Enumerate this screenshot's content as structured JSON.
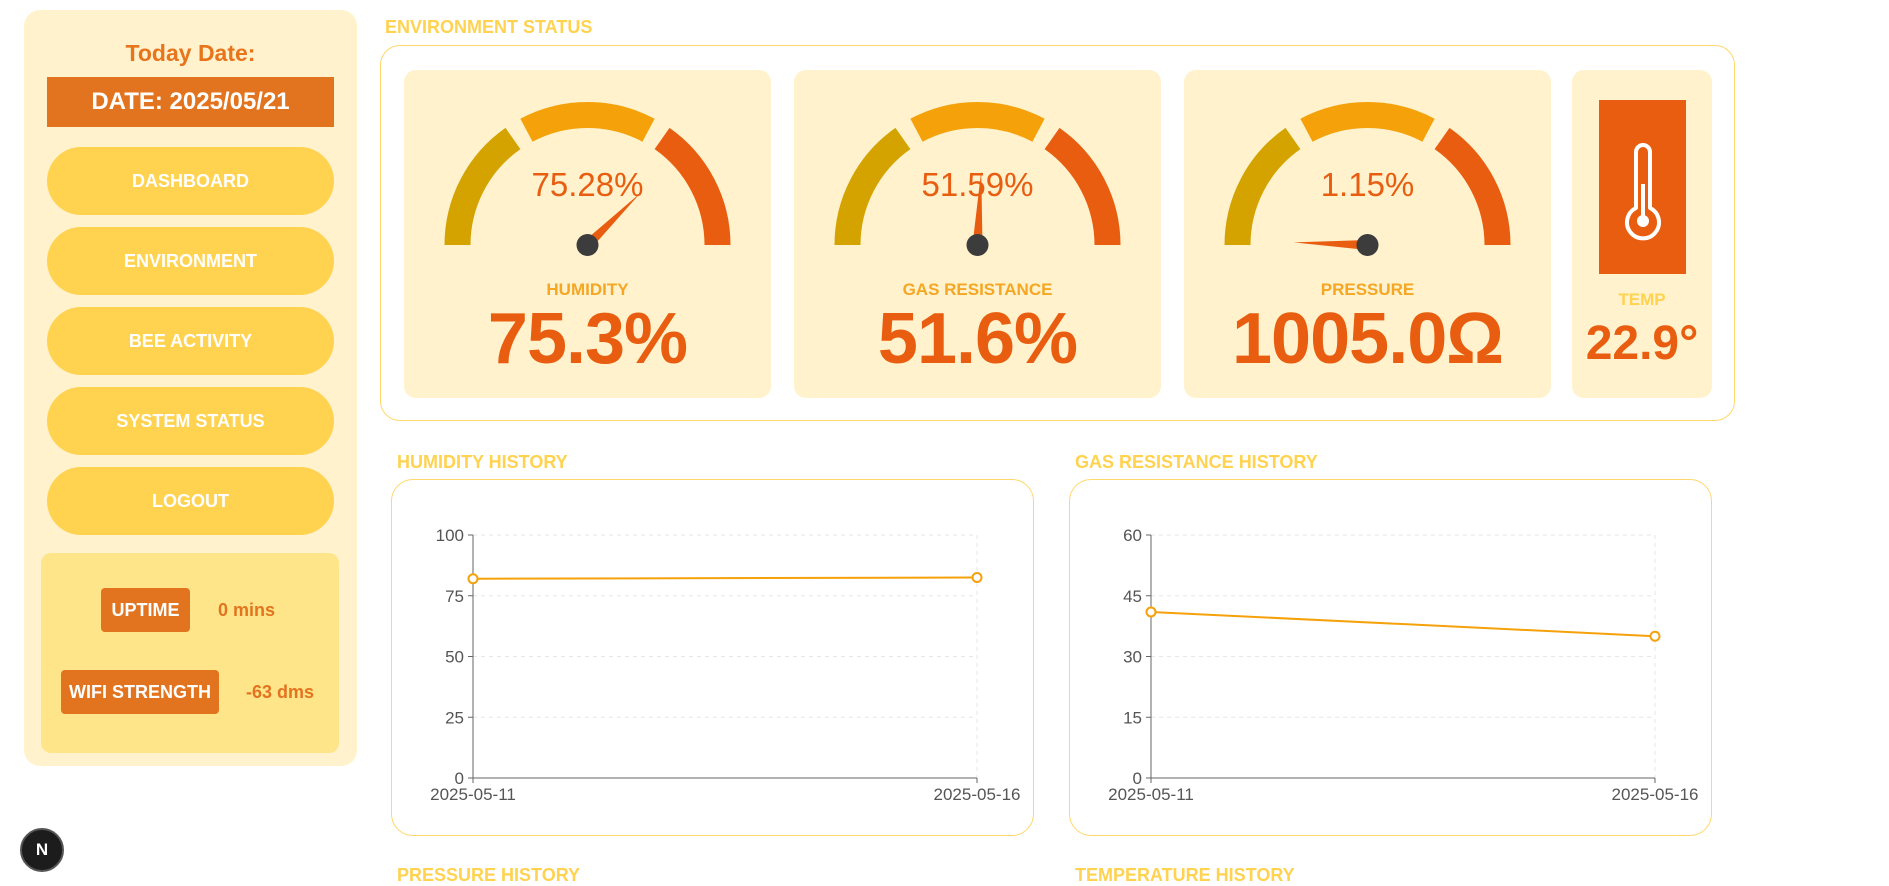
{
  "sidebar": {
    "today_label": "Today Date:",
    "date": "DATE: 2025/05/21",
    "nav": [
      {
        "label": "DASHBOARD"
      },
      {
        "label": "ENVIRONMENT"
      },
      {
        "label": "BEE ACTIVITY"
      },
      {
        "label": "SYSTEM STATUS"
      },
      {
        "label": "LOGOUT"
      }
    ],
    "uptime_label": "UPTIME",
    "uptime_value": "0 mins",
    "wifi_label": "WIFI STRENGTH",
    "wifi_value": "-63 dms"
  },
  "environment": {
    "title": "ENVIRONMENT STATUS",
    "gauges": [
      {
        "label": "HUMIDITY",
        "percent_text": "75.28%",
        "value_text": "75.3%",
        "percent": 75.28
      },
      {
        "label": "GAS RESISTANCE",
        "percent_text": "51.59%",
        "value_text": "51.6%",
        "percent": 51.59
      },
      {
        "label": "PRESSURE",
        "percent_text": "1.15%",
        "value_text": "1005.0Ω",
        "percent": 1.15
      }
    ],
    "temp": {
      "label": "TEMP",
      "value_text": "22.9°",
      "icon": "thermometer-icon"
    }
  },
  "colors": {
    "gauge_low": "#d4a300",
    "gauge_mid": "#f5a10a",
    "gauge_high": "#e85d10",
    "needle": "#e85d10",
    "pivot": "#3c3c3c",
    "line": "#f5a10a"
  },
  "history": {
    "humidity_title": "HUMIDITY HISTORY",
    "gas_title": "GAS RESISTANCE HISTORY",
    "pressure_title": "PRESSURE HISTORY",
    "temperature_title": "TEMPERATURE HISTORY"
  },
  "chart_data": [
    {
      "type": "line",
      "title": "HUMIDITY HISTORY",
      "x": [
        "2025-05-11",
        "2025-05-16"
      ],
      "y_ticks": [
        0,
        25,
        50,
        75,
        100
      ],
      "ylim": [
        0,
        100
      ],
      "series": [
        {
          "values": [
            82,
            82.5
          ]
        }
      ],
      "grid": true
    },
    {
      "type": "line",
      "title": "GAS RESISTANCE HISTORY",
      "x": [
        "2025-05-11",
        "2025-05-16"
      ],
      "y_ticks": [
        0,
        15,
        30,
        45,
        60
      ],
      "ylim": [
        0,
        60
      ],
      "series": [
        {
          "values": [
            41,
            35
          ]
        }
      ],
      "grid": true
    }
  ],
  "floating_button": "N"
}
